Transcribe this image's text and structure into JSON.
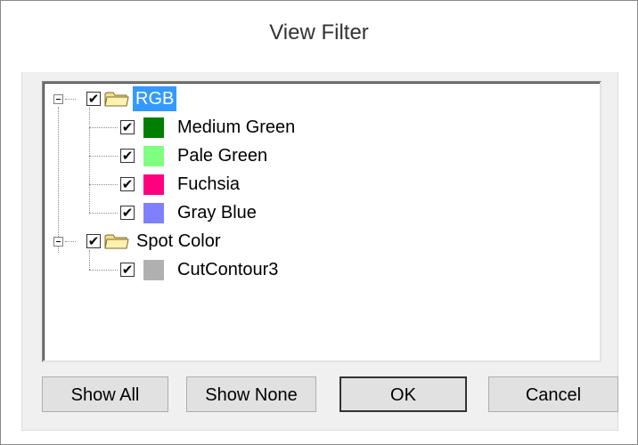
{
  "dialog": {
    "title": "View Filter"
  },
  "tree": {
    "groups": [
      {
        "label": "RGB",
        "checked": true,
        "expanded": true,
        "selected": true,
        "items": [
          {
            "label": "Medium Green",
            "checked": true,
            "color": "#007f00"
          },
          {
            "label": "Pale Green",
            "checked": true,
            "color": "#7fff7f"
          },
          {
            "label": "Fuchsia",
            "checked": true,
            "color": "#ff0080"
          },
          {
            "label": "Gray Blue",
            "checked": true,
            "color": "#8080ff"
          }
        ]
      },
      {
        "label": "Spot Color",
        "checked": true,
        "expanded": true,
        "selected": false,
        "items": [
          {
            "label": "CutContour3",
            "checked": true,
            "color": "#b0b0b0"
          }
        ]
      }
    ]
  },
  "buttons": {
    "show_all": "Show All",
    "show_none": "Show None",
    "ok": "OK",
    "cancel": "Cancel"
  },
  "glyphs": {
    "check": "✔"
  }
}
